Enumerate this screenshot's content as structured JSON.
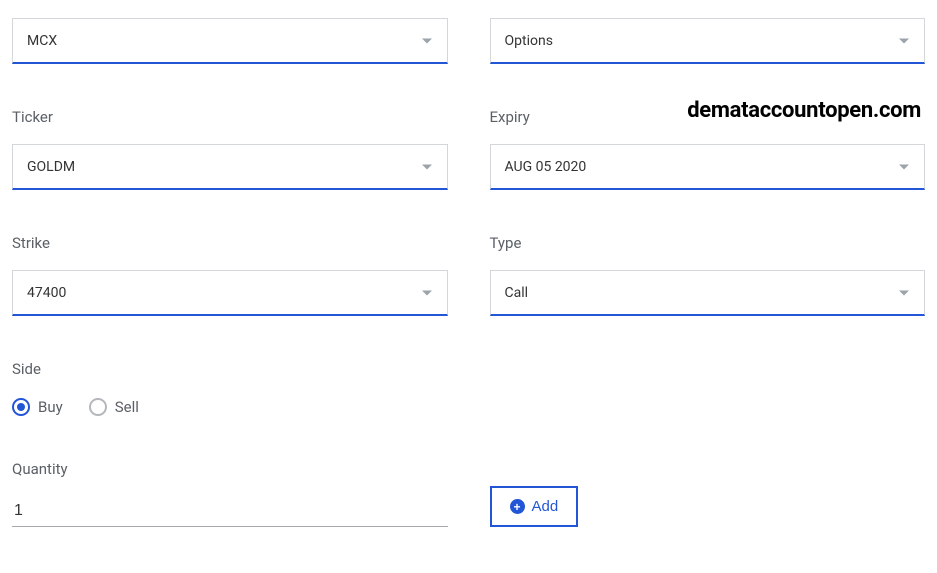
{
  "watermark": "demataccountopen.com",
  "labels": {
    "ticker": "Ticker",
    "expiry": "Expiry",
    "strike": "Strike",
    "type": "Type",
    "side": "Side",
    "quantity": "Quantity"
  },
  "exchange": {
    "value": "MCX"
  },
  "instrument": {
    "value": "Options"
  },
  "ticker": {
    "value": "GOLDM"
  },
  "expiry": {
    "value": "AUG 05 2020"
  },
  "strike": {
    "value": "47400"
  },
  "type": {
    "value": "Call"
  },
  "side": {
    "options": [
      {
        "label": "Buy",
        "checked": true
      },
      {
        "label": "Sell",
        "checked": false
      }
    ]
  },
  "quantity": {
    "value": "1"
  },
  "add_button": {
    "label": "Add"
  }
}
